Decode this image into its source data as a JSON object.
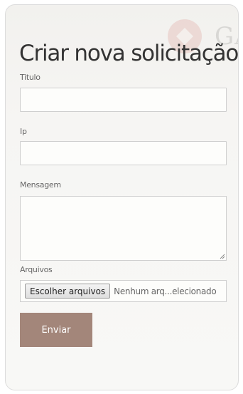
{
  "form": {
    "title": "Criar nova solicitação:",
    "fields": {
      "titulo_label": "Titulo",
      "ip_label": "Ip",
      "mensagem_label": "Mensagem",
      "arquivos_label": "Arquivos"
    },
    "file": {
      "button_label": "Escolher arquivos",
      "status_text": "Nenhum arq...elecionado"
    },
    "submit_label": "Enviar"
  },
  "watermark": {
    "text": "GA"
  },
  "colors": {
    "accent": "#a3867a",
    "watermark_red": "#c0392b"
  }
}
